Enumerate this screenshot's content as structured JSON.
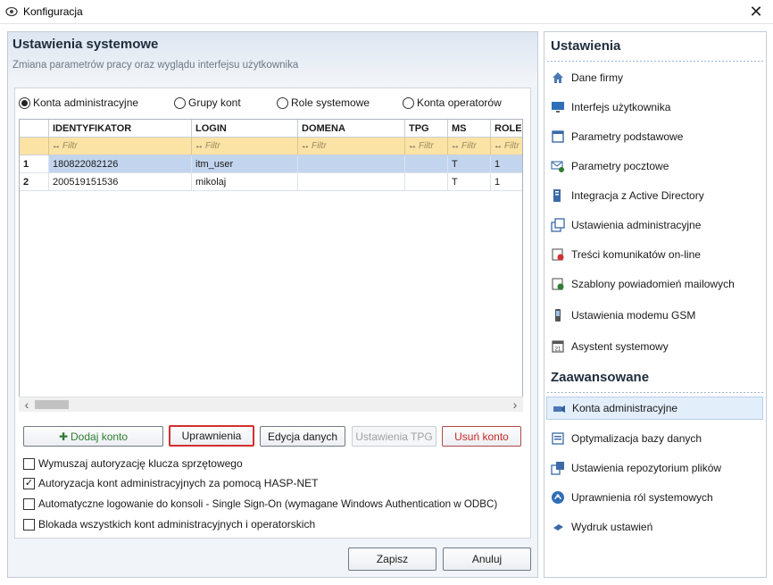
{
  "window": {
    "title": "Konfiguracja"
  },
  "header": {
    "title": "Ustawienia systemowe",
    "subtitle": "Zmiana parametrów pracy oraz wyglądu interfejsu użytkownika"
  },
  "radios": [
    {
      "label": "Konta administracyjne",
      "checked": true
    },
    {
      "label": "Grupy kont",
      "checked": false
    },
    {
      "label": "Role systemowe",
      "checked": false
    },
    {
      "label": "Konta operatorów",
      "checked": false
    }
  ],
  "grid": {
    "columns": [
      "IDENTYFIKATOR",
      "LOGIN",
      "DOMENA",
      "TPG",
      "MS",
      "ROLE"
    ],
    "filter_placeholder": "Filtr",
    "filter_icon": "↔",
    "rows": [
      {
        "num": "1",
        "cells": [
          "180822082126",
          "itm_user",
          "",
          "",
          "T",
          "1"
        ],
        "selected": true
      },
      {
        "num": "2",
        "cells": [
          "200519151536",
          "mikolaj",
          "",
          "",
          "T",
          "1"
        ],
        "selected": false
      }
    ]
  },
  "actions": {
    "add": "Dodaj konto",
    "permissions": "Uprawnienia",
    "edit": "Edycja danych",
    "tpg": "Ustawienia TPG",
    "delete": "Usuń konto"
  },
  "options": [
    {
      "label": "Wymuszaj autoryzację klucza sprzętowego",
      "checked": false
    },
    {
      "label": "Autoryzacja kont administracyjnych za pomocą HASP-NET",
      "checked": true
    },
    {
      "label": "Automatyczne logowanie do konsoli - Single Sign-On (wymagane Windows Authentication w ODBC)",
      "checked": false
    },
    {
      "label": "Blokada wszystkich kont administracyjnych i operatorskich",
      "checked": false
    }
  ],
  "footer": {
    "save": "Zapisz",
    "cancel": "Anuluj"
  },
  "sidebar": {
    "settings_title": "Ustawienia",
    "advanced_title": "Zaawansowane",
    "settings_items": [
      {
        "label": "Dane firmy",
        "icon": "house-icon"
      },
      {
        "label": "Interfejs użytkownika",
        "icon": "monitor-icon"
      },
      {
        "label": "Parametry podstawowe",
        "icon": "window-icon"
      },
      {
        "label": "Parametry pocztowe",
        "icon": "mail-settings-icon"
      },
      {
        "label": "Integracja z Active Directory",
        "icon": "directory-icon"
      },
      {
        "label": "Ustawienia administracyjne",
        "icon": "windows-icon"
      },
      {
        "label": "Treści komunikatów on-line",
        "icon": "message-icon"
      },
      {
        "label": "Szablony powiadomień mailowych",
        "icon": "mail-template-icon"
      },
      {
        "label": "Ustawienia modemu GSM",
        "icon": "phone-icon"
      },
      {
        "label": "Asystent systemowy",
        "icon": "calendar-icon"
      }
    ],
    "advanced_items": [
      {
        "label": "Konta administracyjne",
        "icon": "accounts-icon",
        "active": true
      },
      {
        "label": "Optymalizacja bazy danych",
        "icon": "database-icon"
      },
      {
        "label": "Ustawienia repozytorium plików",
        "icon": "repository-icon"
      },
      {
        "label": "Uprawnienia ról systemowych",
        "icon": "roles-icon"
      },
      {
        "label": "Wydruk ustawień",
        "icon": "printer-icon"
      }
    ]
  },
  "colors": {
    "accent": "#3a7bd5",
    "selected_row": "#c3d5ee",
    "filter_row": "#fbe3a6",
    "highlight_border": "#d32f2f"
  }
}
